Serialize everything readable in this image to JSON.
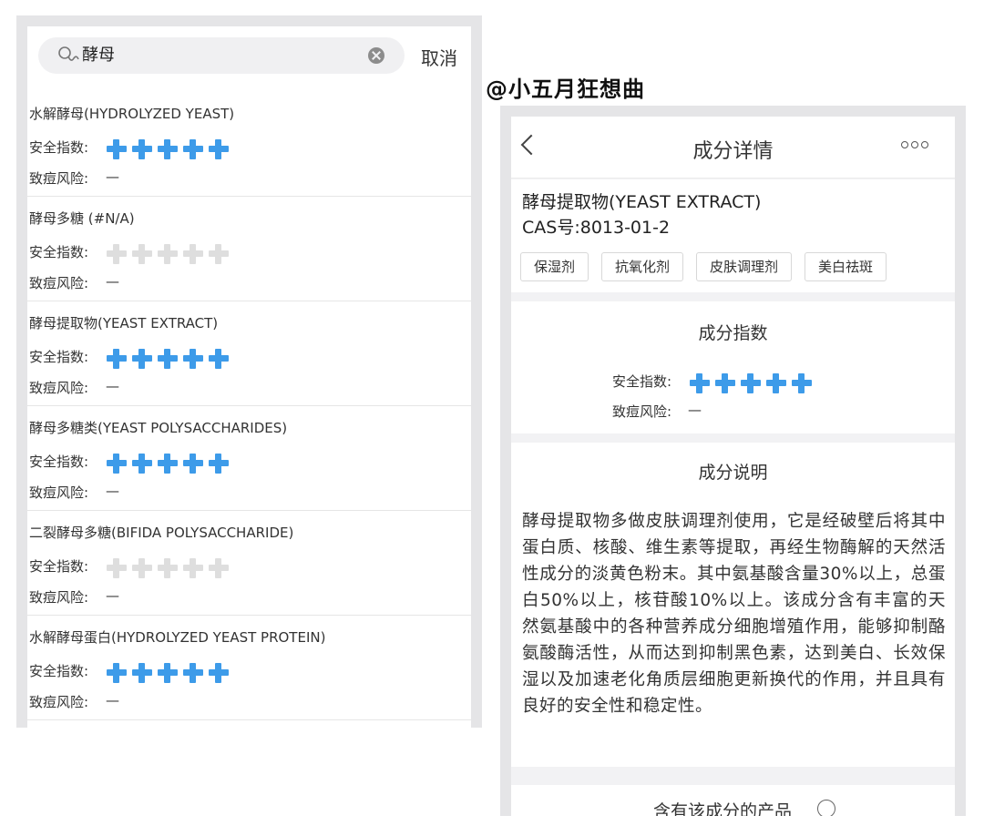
{
  "left_screen": {
    "search": {
      "icon": "search-icon",
      "value": "酵母",
      "clear_icon": "clear-icon",
      "cancel_label": "取消"
    },
    "safety_label": "安全指数:",
    "risk_label": "致痘风险:",
    "results": [
      {
        "name": "水解酵母(HYDROLYZED YEAST)",
        "safety_score": 5,
        "risk": "—"
      },
      {
        "name": "酵母多糖 (#N/A)",
        "safety_score": 0,
        "risk": "—"
      },
      {
        "name": "酵母提取物(YEAST EXTRACT)",
        "safety_score": 5,
        "risk": "—"
      },
      {
        "name": "酵母多糖类(YEAST POLYSACCHARIDES)",
        "safety_score": 5,
        "risk": "—"
      },
      {
        "name": "二裂酵母多糖(BIFIDA POLYSACCHARIDE)",
        "safety_score": 0,
        "risk": "—"
      },
      {
        "name": "水解酵母蛋白(HYDROLYZED YEAST PROTEIN)",
        "safety_score": 5,
        "risk": "—"
      }
    ],
    "max_score": 5
  },
  "watermark": "@小五月狂想曲",
  "right_screen": {
    "nav": {
      "title": "成分详情",
      "back_icon": "chevron-left-icon",
      "more_icon": "more-icon"
    },
    "ingredient": {
      "name": "酵母提取物(YEAST EXTRACT)",
      "cas": "CAS号:8013-01-2",
      "tags": [
        "保湿剂",
        "抗氧化剂",
        "皮肤调理剂",
        "美白祛斑"
      ]
    },
    "index_section": {
      "title": "成分指数",
      "safety_label": "安全指数:",
      "safety_score": 5,
      "risk_label": "致痘风险:",
      "risk": "—"
    },
    "description_section": {
      "title": "成分说明",
      "text": "酵母提取物多做皮肤调理剂使用，它是经破壁后将其中蛋白质、核酸、维生素等提取，再经生物酶解的天然活性成分的淡黄色粉末。其中氨基酸含量30%以上，总蛋白50%以上，核苷酸10%以上。该成分含有丰富的天然氨基酸中的各种营养成分细胞增殖作用，能够抑制酪氨酸酶活性，从而达到抑制黑色素，达到美白、长效保湿以及加速老化角质层细胞更新换代的作用，并且具有良好的安全性和稳定性。"
    },
    "products_section": {
      "title": "含有该成分的产品",
      "info_icon": "info-icon"
    }
  },
  "colors": {
    "accent_blue": "#3d9be9",
    "inactive_gray": "#dedede",
    "frame_gray": "#e5e5e7"
  }
}
